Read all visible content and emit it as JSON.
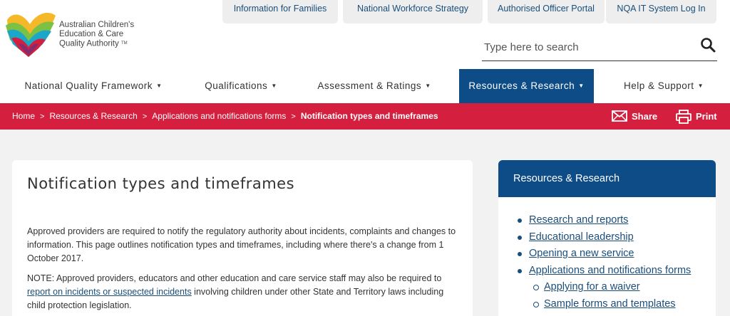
{
  "logo": {
    "line1": "Australian Children's",
    "line2": "Education & Care",
    "line3": "Quality Authority",
    "tm": "TM"
  },
  "toplinks": [
    {
      "label": "Information for Families"
    },
    {
      "label": "National Workforce Strategy"
    },
    {
      "label": "Authorised Officer Portal"
    },
    {
      "label": "NQA IT System Log In"
    }
  ],
  "search": {
    "placeholder": "Type here to search",
    "icon": "search-icon"
  },
  "nav": [
    {
      "label": "National Quality Framework"
    },
    {
      "label": "Qualifications"
    },
    {
      "label": "Assessment & Ratings"
    },
    {
      "label": "Resources & Research"
    },
    {
      "label": "Help & Support"
    }
  ],
  "breadcrumb": {
    "items": [
      "Home",
      "Resources & Research",
      "Applications and notifications forms"
    ],
    "current": "Notification types and timeframes",
    "separator": ">"
  },
  "actions": {
    "share": "Share",
    "print": "Print"
  },
  "article": {
    "title": "Notification types and timeframes",
    "p1": "Approved providers are required to notify the regulatory authority about incidents, complaints and changes to information. This page outlines notification types and timeframes, including where there's a change from 1 October 2017.",
    "p2_before": "NOTE: Approved providers, educators and other education and care service staff may also be required to ",
    "p2_link": "report on incidents or suspected incidents",
    "p2_after": " involving children under other State and Territory laws including child protection legislation."
  },
  "sidebar": {
    "heading": "Resources & Research",
    "items": [
      {
        "label": "Research and reports"
      },
      {
        "label": "Educational leadership"
      },
      {
        "label": "Opening a new service"
      },
      {
        "label": "Applications and notifications forms"
      },
      {
        "label": "Applying for a waiver"
      },
      {
        "label": "Sample forms and templates"
      }
    ]
  },
  "colors": {
    "brand_blue": "#0d4c86",
    "brand_red": "#d41f3f",
    "link": "#1a4e7a"
  }
}
